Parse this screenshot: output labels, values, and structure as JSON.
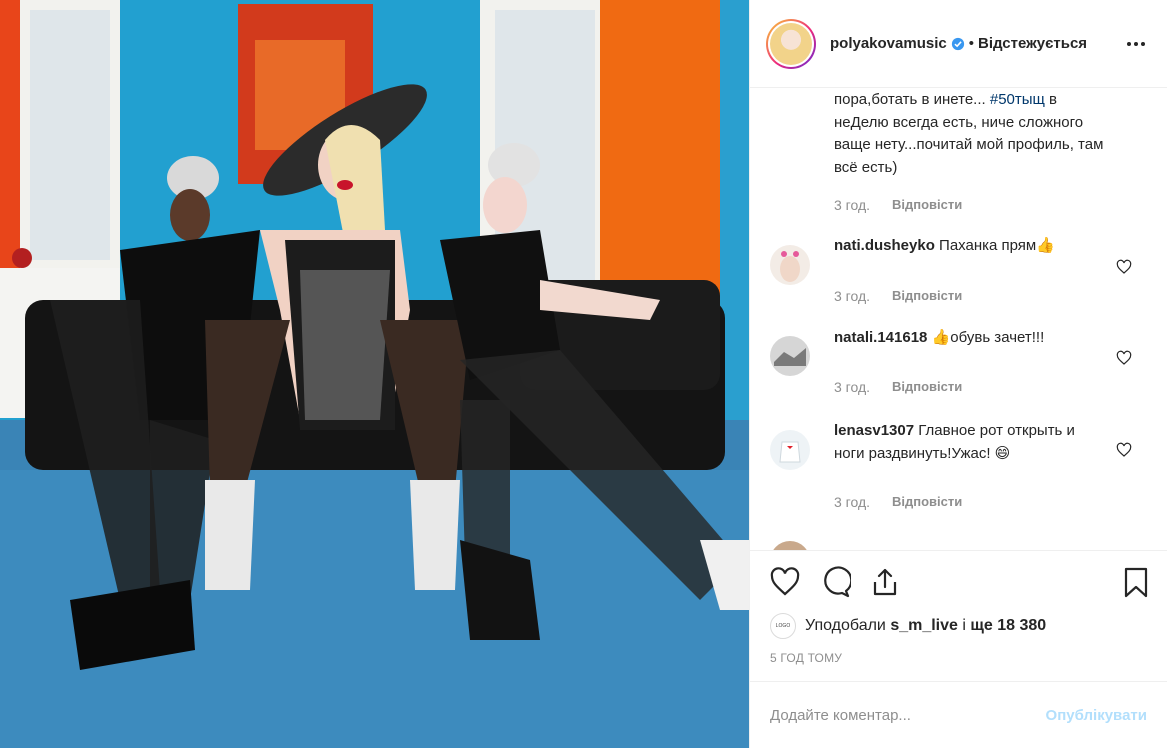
{
  "header": {
    "username": "polyakovamusic",
    "separator": "•",
    "follow_status": "Відстежується"
  },
  "comments": {
    "caption_tail": {
      "text_before": "пора,ботать в инете... ",
      "hashtag": "#50тыщ",
      "text_after": " в неДелю всегда есть, ниче сложного ваще нету...почитай мой профиль, там всё есть)",
      "time": "3 год.",
      "reply": "Відповісти"
    },
    "items": [
      {
        "user": "nati.dusheyko",
        "text": "Паханка прям👍",
        "time": "3 год.",
        "reply": "Відповісти"
      },
      {
        "user": "natali.141618",
        "text": "👍обувь зачет!!!",
        "time": "3 год.",
        "reply": "Відповісти"
      },
      {
        "user": "lenasv1307",
        "text": "Главное рот открыть и ноги раздвинуть!Ужас! 😄",
        "time": "3 год.",
        "reply": "Відповісти"
      }
    ]
  },
  "likes": {
    "prefix": "Уподобали",
    "user": "s_m_live",
    "middle": "і",
    "count": "ще 18 380"
  },
  "timestamp": "5 ГОД ТОМУ",
  "add_comment": {
    "placeholder": "Додайте коментар...",
    "post_label": "Опублікувати"
  },
  "colors": {
    "accent": "#0095f6",
    "post_disabled": "#b2dffc",
    "muted": "#8e8e8e",
    "hashtag": "#00376b"
  }
}
